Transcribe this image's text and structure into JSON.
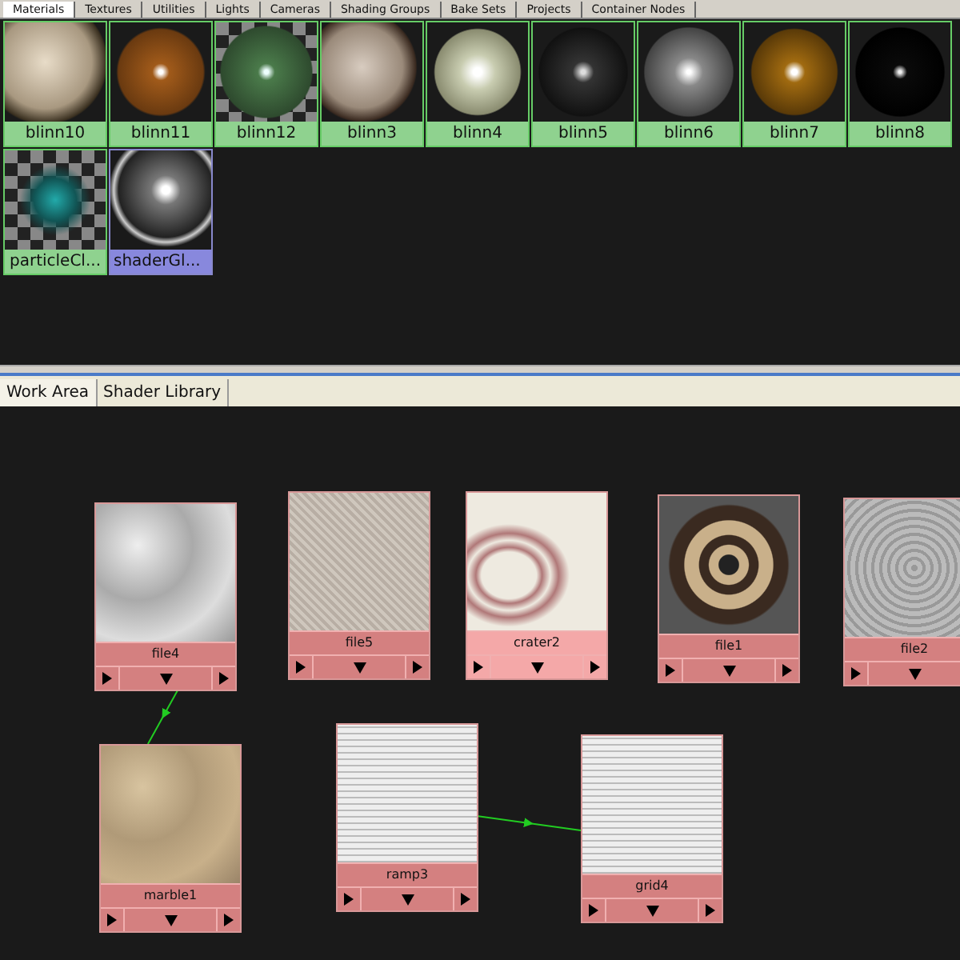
{
  "top_tabs": [
    {
      "label": "Materials",
      "selected": true
    },
    {
      "label": "Textures",
      "selected": false
    },
    {
      "label": "Utilities",
      "selected": false
    },
    {
      "label": "Lights",
      "selected": false
    },
    {
      "label": "Cameras",
      "selected": false
    },
    {
      "label": "Shading Groups",
      "selected": false
    },
    {
      "label": "Bake Sets",
      "selected": false
    },
    {
      "label": "Projects",
      "selected": false
    },
    {
      "label": "Container Nodes",
      "selected": false
    }
  ],
  "swatches": [
    {
      "label": "blinn10",
      "kind": "material"
    },
    {
      "label": "blinn11",
      "kind": "material"
    },
    {
      "label": "blinn12",
      "kind": "material"
    },
    {
      "label": "blinn3",
      "kind": "material"
    },
    {
      "label": "blinn4",
      "kind": "material"
    },
    {
      "label": "blinn5",
      "kind": "material"
    },
    {
      "label": "blinn6",
      "kind": "material"
    },
    {
      "label": "blinn7",
      "kind": "material"
    },
    {
      "label": "blinn8",
      "kind": "material"
    },
    {
      "label": "particleCl...",
      "kind": "material"
    },
    {
      "label": "shaderGl...",
      "kind": "shader"
    }
  ],
  "bottom_tabs": [
    {
      "label": "Work Area",
      "selected": true
    },
    {
      "label": "Shader Library",
      "selected": false
    }
  ],
  "nodes": [
    {
      "label": "file4",
      "selected": false
    },
    {
      "label": "file5",
      "selected": false
    },
    {
      "label": "crater2",
      "selected": true
    },
    {
      "label": "file1",
      "selected": false
    },
    {
      "label": "file2",
      "selected": false
    },
    {
      "label": "marble1",
      "selected": false
    },
    {
      "label": "ramp3",
      "selected": false
    },
    {
      "label": "grid4",
      "selected": false
    }
  ]
}
